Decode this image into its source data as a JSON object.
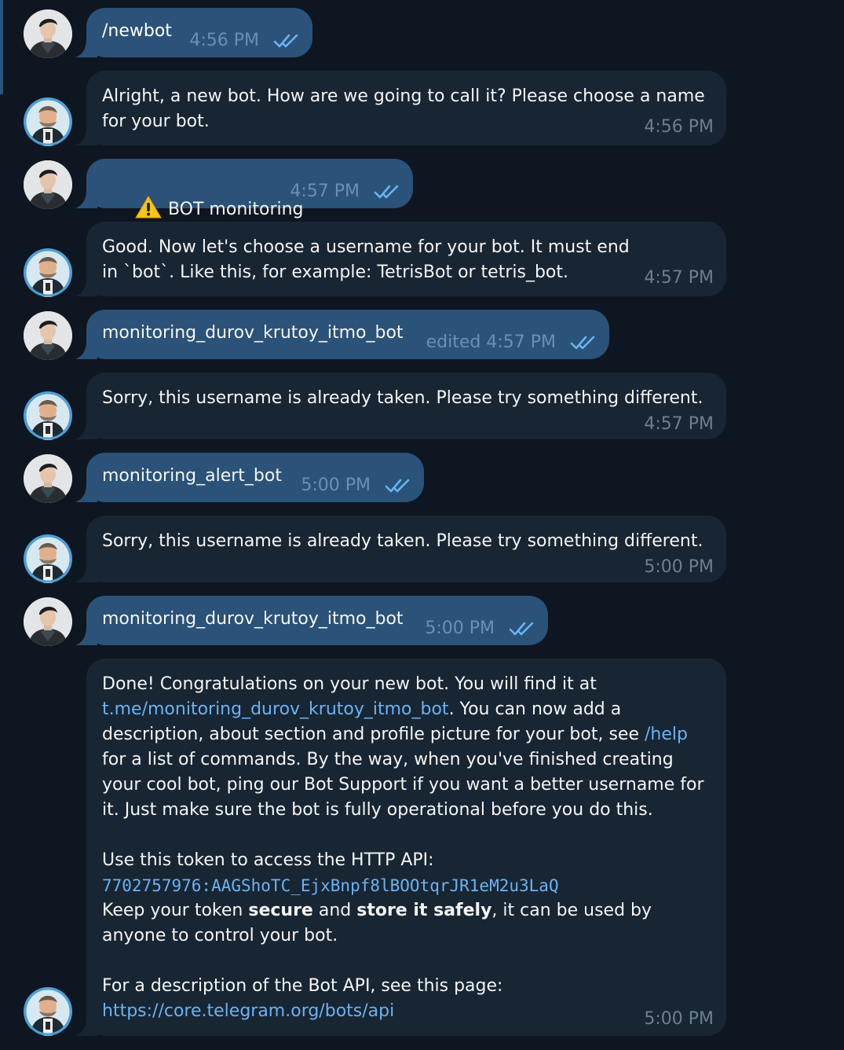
{
  "chat": {
    "messages": [
      {
        "id": 1,
        "direction": "out",
        "text": "/newbot",
        "time": "4:56 PM",
        "edited": false,
        "read": true
      },
      {
        "id": 2,
        "direction": "in",
        "text": "Alright, a new bot. How are we going to call it? Please choose a name for your bot.",
        "time": "4:56 PM"
      },
      {
        "id": 3,
        "direction": "out",
        "text": "BOT monitoring",
        "emoji": "warning-sign",
        "time": "4:57 PM",
        "edited": false,
        "read": true
      },
      {
        "id": 4,
        "direction": "in",
        "text": "Good. Now let's choose a username for your bot. It must end in `bot`. Like this, for example: TetrisBot or tetris_bot.",
        "time": "4:57 PM"
      },
      {
        "id": 5,
        "direction": "out",
        "text": "monitoring_durov_krutoy_itmo_bot",
        "time": "edited 4:57 PM",
        "edited": true,
        "read": true
      },
      {
        "id": 6,
        "direction": "in",
        "text": "Sorry, this username is already taken. Please try something different.",
        "time": "4:57 PM"
      },
      {
        "id": 7,
        "direction": "out",
        "text": "monitoring_alert_bot",
        "time": "5:00 PM",
        "edited": false,
        "read": true
      },
      {
        "id": 8,
        "direction": "in",
        "text": "Sorry, this username is already taken. Please try something different.",
        "time": "5:00 PM"
      },
      {
        "id": 9,
        "direction": "out",
        "text": "monitoring_durov_krutoy_itmo_bot",
        "time": "5:00 PM",
        "edited": false,
        "read": true
      },
      {
        "id": 10,
        "direction": "in",
        "time": "5:00 PM",
        "parts": {
          "p1_a": "Done! Congratulations on your new bot. You will find it at ",
          "p1_link": "t.me/monitoring_durov_krutoy_itmo_bot",
          "p1_b": ". You can now add a description, about section and profile picture for your bot, see ",
          "p1_help": "/help",
          "p1_c": " for a list of commands. By the way, when you've finished creating your cool bot, ping our Bot Support if you want a better username for it. Just make sure the bot is fully operational before you do this.",
          "p2_a": "Use this token to access the HTTP API:",
          "token": "7702757976:AAGShoTC_EjxBnpf8lBOOtqrJR1eM2u3LaQ",
          "p2_b": "Keep your token ",
          "p2_secure": "secure",
          "p2_and": " and ",
          "p2_store": "store it safely",
          "p2_c": ", it can be used by anyone to control your bot.",
          "p3_a": "For a description of the Bot API, see this page:",
          "p3_link": "https://core.telegram.org/bots/api"
        }
      }
    ]
  },
  "colors": {
    "background": "#0e1621",
    "outgoing_bubble": "#2b5278",
    "incoming_bubble": "#182533",
    "link": "#6ab3f3",
    "read_check": "#6ab3f3"
  },
  "icons": {
    "user_avatar": "user-avatar-photo",
    "bot_avatar": "botfather-avatar",
    "read_receipt": "double-check-icon",
    "warning": "warning-sign-emoji"
  }
}
